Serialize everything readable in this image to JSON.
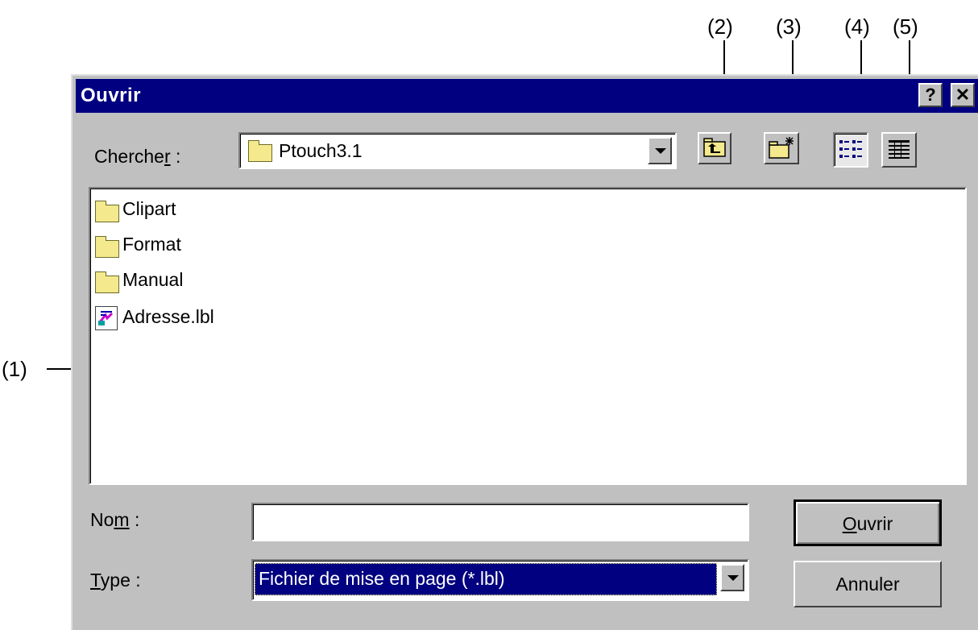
{
  "annotations": [
    "(1)",
    "(2)",
    "(3)",
    "(4)",
    "(5)"
  ],
  "dialog": {
    "title": "Ouvrir",
    "help_label": "?",
    "close_label": "✕"
  },
  "look_in": {
    "label_main": "Cherche",
    "label_underlined": "r",
    "label_suffix": " :",
    "value": "Ptouch3.1"
  },
  "toolbar": {
    "up_icon": "up-one-level-icon",
    "new_folder_icon": "new-folder-icon",
    "list_icon": "list-view-icon",
    "details_icon": "details-view-icon"
  },
  "files": [
    {
      "name": "Clipart",
      "type": "folder"
    },
    {
      "name": "Format",
      "type": "folder"
    },
    {
      "name": "Manual",
      "type": "folder"
    },
    {
      "name": "Adresse.lbl",
      "type": "file"
    }
  ],
  "name_field": {
    "label_pre": "No",
    "label_underlined": "m",
    "label_suffix": " :",
    "value": ""
  },
  "type_field": {
    "label_underlined": "T",
    "label_rest": "ype",
    "label_suffix": " :",
    "value": "Fichier de mise en page (*.lbl)"
  },
  "buttons": {
    "open_underlined": "O",
    "open_rest": "uvrir",
    "cancel": "Annuler"
  },
  "colors": {
    "titlebar": "#000080",
    "face": "#c0c0c0",
    "selection": "#000080"
  }
}
